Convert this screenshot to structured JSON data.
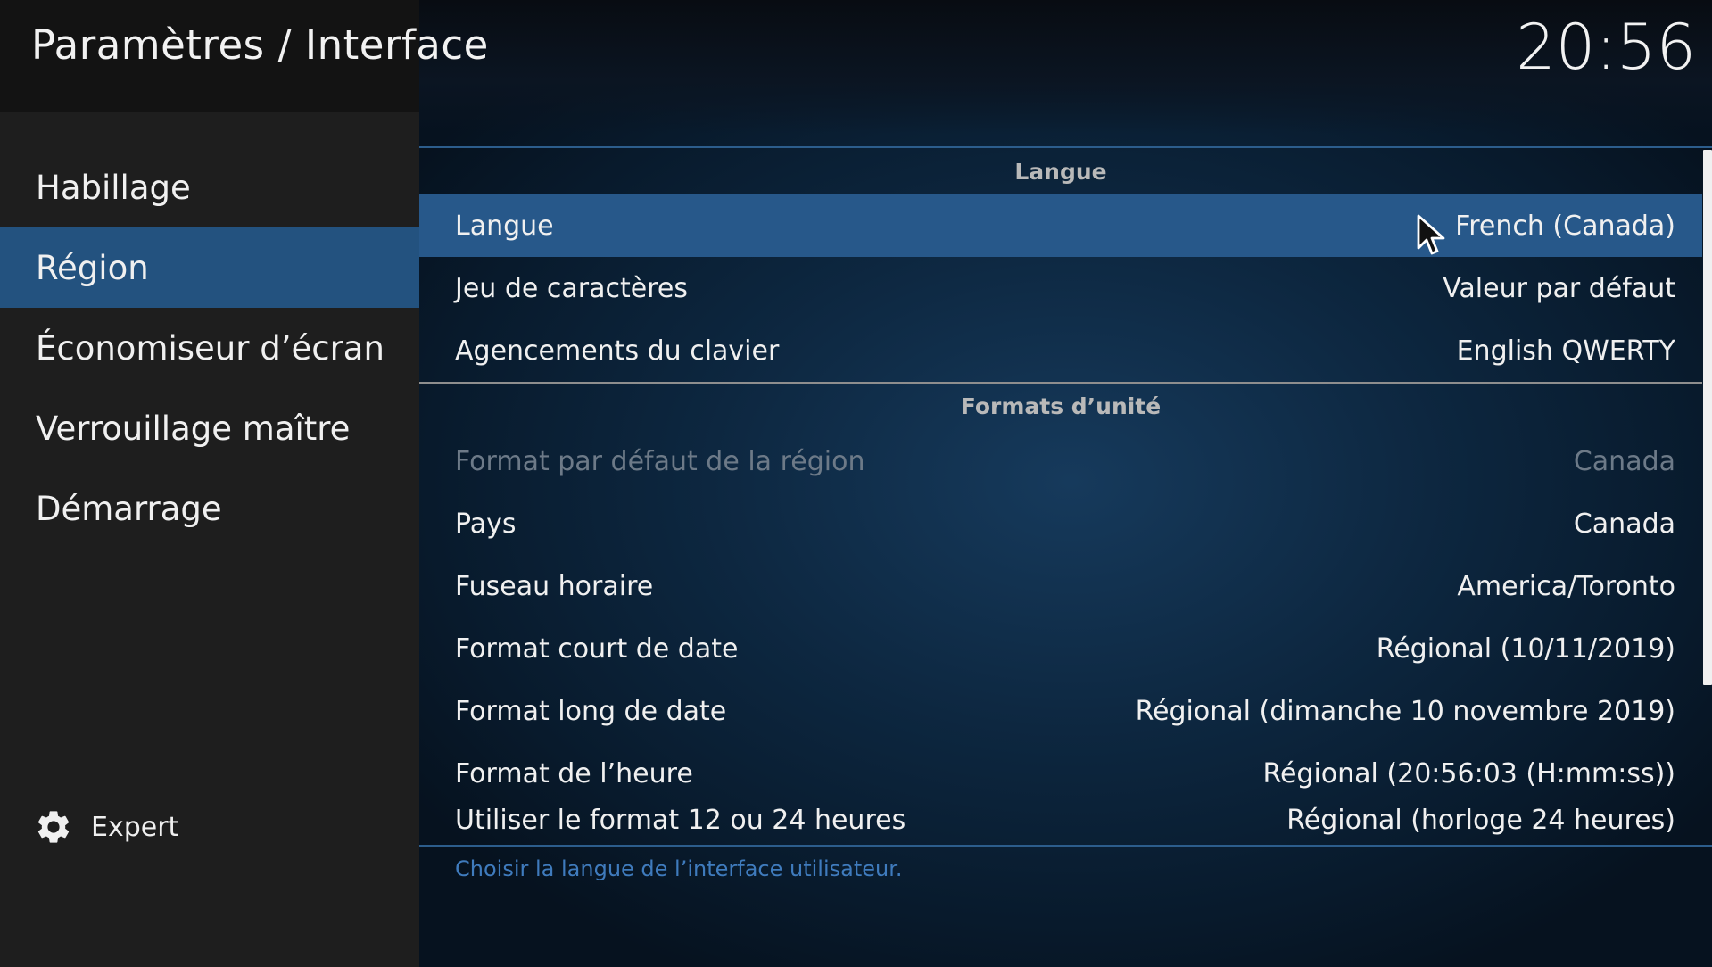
{
  "header": {
    "title": "Paramètres / Interface",
    "clock": "20:56"
  },
  "sidebar": {
    "items": [
      {
        "label": "Habillage"
      },
      {
        "label": "Région",
        "active": true
      },
      {
        "label": "Économiseur d’écran"
      },
      {
        "label": "Verrouillage maître"
      },
      {
        "label": "Démarrage"
      }
    ],
    "expert": {
      "label": "Expert",
      "icon": "gear-icon"
    }
  },
  "sections": [
    {
      "title": "Langue",
      "rows": [
        {
          "label": "Langue",
          "value": "French (Canada)",
          "selected": true
        },
        {
          "label": "Jeu de caractères",
          "value": "Valeur par défaut"
        },
        {
          "label": "Agencements du clavier",
          "value": "English QWERTY"
        }
      ]
    },
    {
      "title": "Formats d’unité",
      "rows": [
        {
          "label": "Format par défaut de la région",
          "value": "Canada",
          "disabled": true
        },
        {
          "label": "Pays",
          "value": "Canada"
        },
        {
          "label": "Fuseau horaire",
          "value": "America/Toronto"
        },
        {
          "label": "Format court de date",
          "value": "Régional (10/11/2019)"
        },
        {
          "label": "Format long de date",
          "value": "Régional (dimanche 10 novembre 2019)"
        },
        {
          "label": "Format de l’heure",
          "value": "Régional (20:56:03 (H:mm:ss))"
        },
        {
          "label": "Utiliser le format 12 ou 24 heures",
          "value": "Régional (horloge 24 heures)"
        }
      ]
    }
  ],
  "description": "Choisir la langue de l’interface utilisateur.",
  "colors": {
    "accent": "#27588a",
    "sidebar": "#1e1e1e",
    "description": "#3f7bbd"
  }
}
